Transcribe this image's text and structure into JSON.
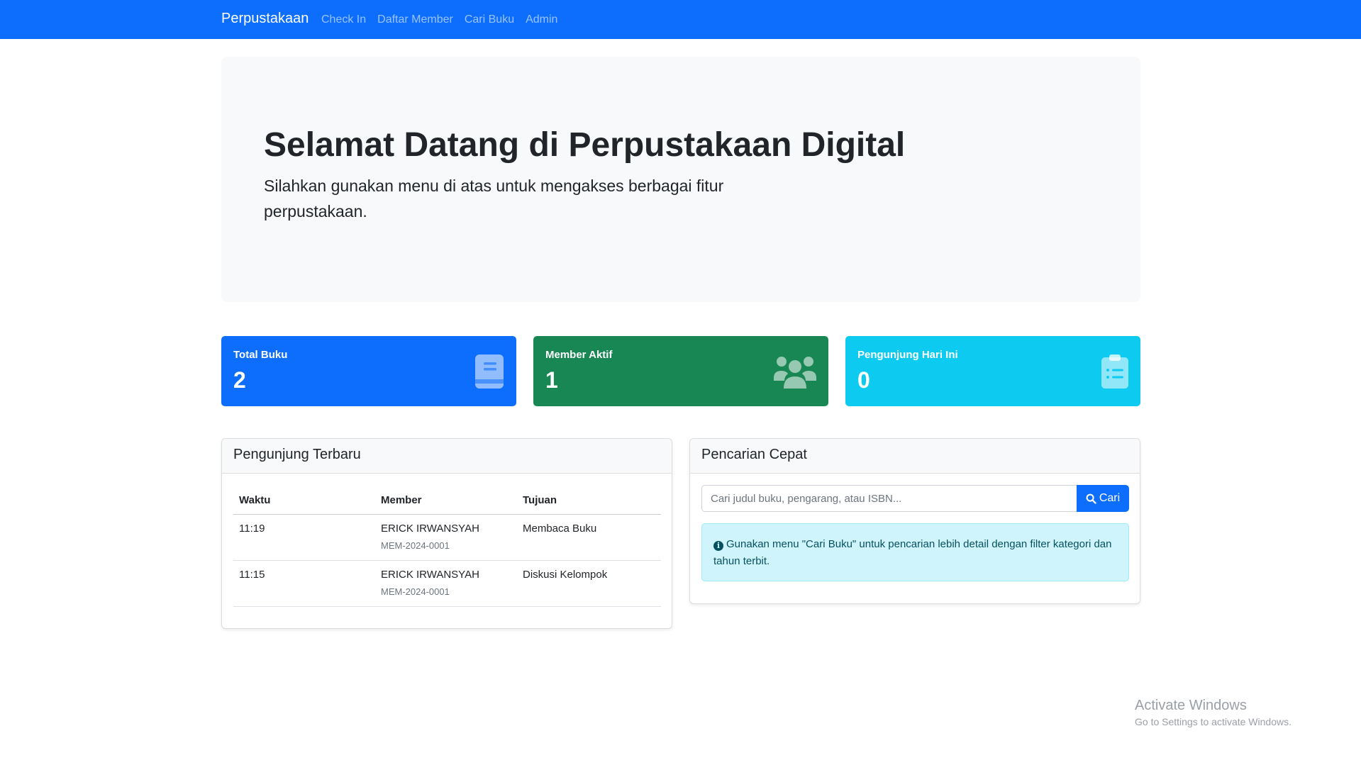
{
  "navbar": {
    "brand": "Perpustakaan",
    "links": [
      "Check In",
      "Daftar Member",
      "Cari Buku",
      "Admin"
    ]
  },
  "hero": {
    "title": "Selamat Datang di Perpustakaan Digital",
    "subtitle": "Silahkan gunakan menu di atas untuk mengakses berbagai fitur perpustakaan."
  },
  "stats": [
    {
      "label": "Total Buku",
      "value": "2",
      "icon": "book-icon",
      "color": "#0d6efd"
    },
    {
      "label": "Member Aktif",
      "value": "1",
      "icon": "users-icon",
      "color": "#198754"
    },
    {
      "label": "Pengunjung Hari Ini",
      "value": "0",
      "icon": "clipboard-list-icon",
      "color": "#0dcaf0"
    }
  ],
  "visitors": {
    "title": "Pengunjung Terbaru",
    "columns": [
      "Waktu",
      "Member",
      "Tujuan"
    ],
    "rows": [
      {
        "time": "11:19",
        "name": "ERICK IRWANSYAH",
        "member_id": "MEM-2024-0001",
        "purpose": "Membaca Buku"
      },
      {
        "time": "11:15",
        "name": "ERICK IRWANSYAH",
        "member_id": "MEM-2024-0001",
        "purpose": "Diskusi Kelompok"
      }
    ]
  },
  "search": {
    "title": "Pencarian Cepat",
    "placeholder": "Cari judul buku, pengarang, atau ISBN...",
    "button_label": "Cari",
    "info": "Gunakan menu \"Cari Buku\" untuk pencarian lebih detail dengan filter kategori dan tahun terbit."
  },
  "watermark": {
    "line1": "Activate Windows",
    "line2": "Go to Settings to activate Windows."
  }
}
